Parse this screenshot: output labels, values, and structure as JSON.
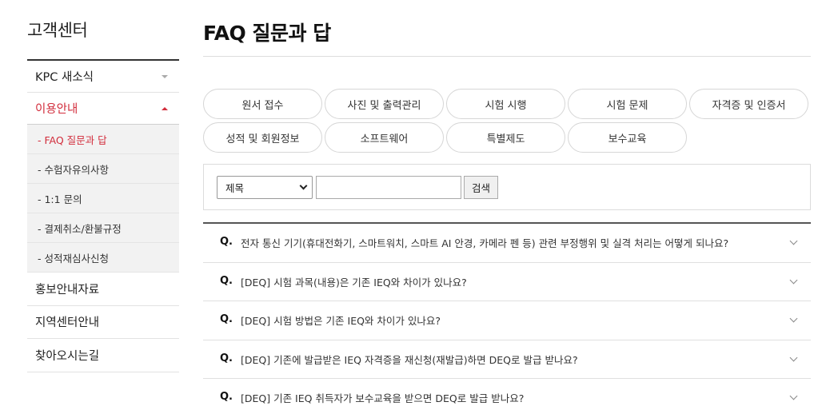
{
  "sidebar": {
    "title": "고객센터",
    "items": [
      {
        "label": "KPC 새소식"
      },
      {
        "label": "이용안내"
      },
      {
        "label": "홍보안내자료"
      },
      {
        "label": "지역센터안내"
      },
      {
        "label": "찾아오시는길"
      }
    ],
    "submenu": [
      {
        "label": "- FAQ 질문과 답"
      },
      {
        "label": "- 수험자유의사항"
      },
      {
        "label": "- 1:1 문의"
      },
      {
        "label": "- 결제취소/환불규정"
      },
      {
        "label": "- 성적재심사신청"
      }
    ]
  },
  "page": {
    "title": "FAQ 질문과 답"
  },
  "categories": [
    "원서 접수",
    "사진 및 출력관리",
    "시험 시행",
    "시험 문제",
    "자격증 및 인증서",
    "성적 및 회원정보",
    "소프트웨어",
    "특별제도",
    "보수교육"
  ],
  "search": {
    "select_value": "제목",
    "input_value": "",
    "button_label": "검색"
  },
  "faq": {
    "q_marker": "Q.",
    "items": [
      "전자 통신 기기(휴대전화기, 스마트워치, 스마트 AI 안경, 카메라 펜 등) 관련 부정행위 및 실격 처리는 어떻게 되나요?",
      "[DEQ] 시험 과목(내용)은 기존 IEQ와 차이가 있나요?",
      "[DEQ] 시험 방법은 기존 IEQ와 차이가 있나요?",
      "[DEQ] 기존에 발급받은 IEQ 자격증을 재신청(재발급)하면 DEQ로 발급 받나요?",
      "[DEQ] 기존 IEQ 취득자가 보수교육을 받으면 DEQ로 발급 받나요?"
    ]
  },
  "colors": {
    "accent": "#d22d3c"
  }
}
